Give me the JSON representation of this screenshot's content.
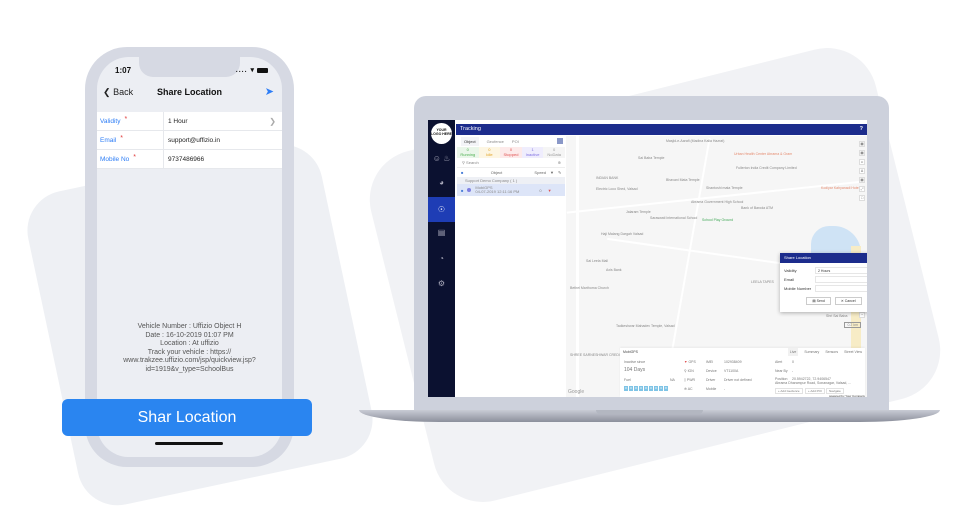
{
  "phone": {
    "status": {
      "time": "1:07",
      "signal": "....",
      "wifi": "wifi-icon",
      "battery": "battery-icon"
    },
    "nav": {
      "back_label": "Back",
      "title": "Share Location",
      "action_icon": "location-arrow-icon"
    },
    "form": [
      {
        "label": "Validity",
        "required": "*",
        "value": "1 Hour",
        "has_chevron": true
      },
      {
        "label": "Email",
        "required": "*",
        "value": "support@uffizio.in"
      },
      {
        "label": "Mobile No",
        "required": "*",
        "value": "9737486966"
      }
    ],
    "message": [
      "Vehicle Number : Uffizio Object H",
      "Date : 16-10-2019 01:07 PM",
      "Location : At uffizio",
      "Track your vehicle : https://",
      "www.trakzee.uffizio.com/jsp/quickview.jsp?",
      "id=1919&v_type=SchoolBus"
    ],
    "share_button": "Shar Location",
    "accent": "#2a85f0"
  },
  "laptop": {
    "logo_text": "YOUR LOGO HERE",
    "topbar": {
      "title": "Tracking",
      "help": "?"
    },
    "panel": {
      "tabs": [
        "Object",
        "Geofence",
        "POI"
      ],
      "counts": [
        {
          "n": "0",
          "label": "Running",
          "color": "#4caf50",
          "bg": "#eaf6ea"
        },
        {
          "n": "0",
          "label": "Idle",
          "color": "#e0a020",
          "bg": "#fdf6e3"
        },
        {
          "n": "0",
          "label": "Stopped",
          "color": "#e05050",
          "bg": "#fdeaea"
        },
        {
          "n": "1",
          "label": "Inactive",
          "color": "#7e6ee0",
          "bg": "#efedfd"
        },
        {
          "n": "0",
          "label": "NoData",
          "color": "#999999",
          "bg": "#f5f5f5"
        }
      ],
      "search_placeholder": "Search",
      "columns": [
        "Object",
        "Speed"
      ],
      "group": "Support Demo Company ( 1 )",
      "object": {
        "name": "MobiGPS",
        "time": "04-07-2019 12:11:16 PM",
        "speed": "0"
      }
    },
    "map_labels": [
      "Masjid-e-Aarafi (Madina Kalia Hazrat)",
      "Sai Baba Temple",
      "Urban Health Center Abrama & Gram",
      "Fullerton India Credit Company Limited",
      "INDIAN BANK",
      "Bhavani Mata Temple",
      "Shantoshi mata Temple",
      "Electric Loco Shed, Valsad",
      "Abrama Government High School",
      "Bank of Baroda ATM",
      "Jalaram Temple",
      "Saraswati International School",
      "School Play Ground",
      "Kodiyar Kahyanadi Hotel",
      "Haji Malang Dargah Valsad",
      "Tipco Industries Limited",
      "Sai Leela Mall",
      "Axis Bank",
      "Bethel Marthoma Church",
      "LEELA TAPES",
      "ICICI Bank Abrama Valsad - Branch & ATM",
      "Shri Sai Baba",
      "Tadkeshwar Mahadev Temple, Valsad",
      "SHREE SARNESHWAR CREDIT"
    ],
    "modal": {
      "title": "Share Location",
      "close": "×",
      "validity_label": "Validity",
      "validity_value": "2 Hours",
      "email_label": "Email",
      "mobile_label": "Mobile Number",
      "send": "Send",
      "cancel": "Cancel"
    },
    "details": {
      "name": "MobiGPS",
      "tabs": [
        "Live",
        "Summary",
        "Sensors",
        "Street View"
      ],
      "inactive_label": "Inactive since",
      "inactive_value": "104 Days",
      "fuel_label": "Fuel",
      "fuel_value": "NA",
      "odometer": [
        "0",
        "0",
        "0",
        "0",
        "0",
        "0",
        "0",
        "3",
        "8"
      ],
      "sensors": [
        "GPS",
        "IGN",
        "PWR",
        "AC"
      ],
      "imei_label": "IMEI",
      "imei_value": "102938409",
      "device_label": "Device",
      "device_value": "VT1100A",
      "driver_label": "Driver",
      "driver_value": "Driver not defined",
      "mobile_label": "Mobile",
      "mobile_value": "-",
      "alert_label": "Alert",
      "alert_value": "0",
      "nearby_label": "Near By",
      "nearby_value": "-",
      "position_label": "Position",
      "position_value": "20.5942722, 72.9406547",
      "address": "Abrama Dharampur Road, Sonanagar, Valsad, ...",
      "actions": [
        "+ Add Geofence",
        "+ Add POI",
        "Navigate"
      ],
      "powered": "powered by Your Company"
    },
    "google": "Google",
    "scale": "0.2 km"
  }
}
